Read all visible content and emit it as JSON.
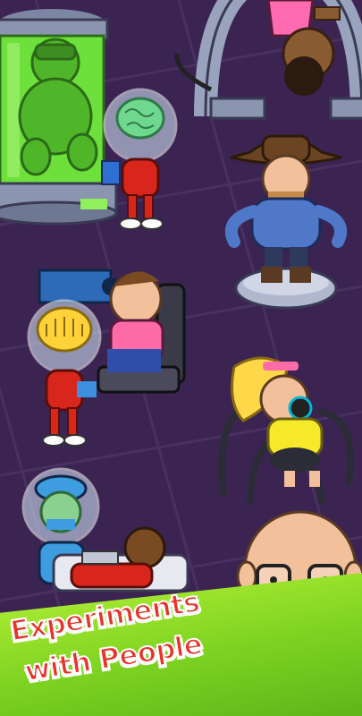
{
  "banner": {
    "line1": "Experiments",
    "line2": "with People"
  },
  "colors": {
    "background": "#3b2452",
    "floor_tile": "#4a3263",
    "banner_green": "#7ed321",
    "banner_text": "#e8332a",
    "tank_liquid": "#6ee03b",
    "alien_suit": "#d9261c",
    "helmet_glass": "#d9ecff"
  },
  "scene": {
    "characters": [
      "green-tank-subject",
      "upside-down-girl",
      "brain-alien",
      "cowboy",
      "chair-subject",
      "yellow-helmet-alien",
      "blonde-girl-mask",
      "surgeon-alien",
      "saw-table-patient",
      "bald-mustache-man"
    ]
  }
}
